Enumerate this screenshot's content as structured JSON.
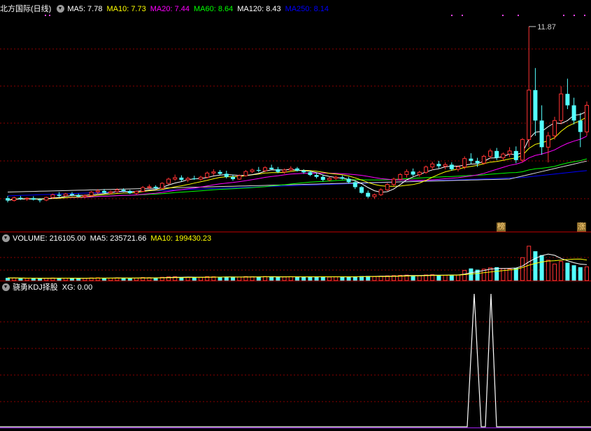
{
  "main": {
    "stock": "北方国际(日线)",
    "ma": [
      {
        "label": "MA5: 7.78",
        "color": "#ffffff"
      },
      {
        "label": "MA10: 7.73",
        "color": "#ffff00"
      },
      {
        "label": "MA20: 7.44",
        "color": "#ff00ff"
      },
      {
        "label": "MA60: 8.64",
        "color": "#00ff00"
      },
      {
        "label": "MA120: 8.43",
        "color": "#ffffff"
      },
      {
        "label": "MA250: 8.14",
        "color": "#0000ff"
      }
    ],
    "high_label": "11.87",
    "tags": {
      "bang": "榜",
      "zhang": "涨"
    }
  },
  "volume": {
    "label": "VOLUME: 216105.00",
    "ma5": "MA5: 235721.66",
    "ma10": "MA10: 199430.23"
  },
  "kdj": {
    "title": "骁勇KDJ择股",
    "xg": "XG: 0.00"
  },
  "colors": {
    "up": "#ff3232",
    "down": "#54ffff",
    "grid": "#8b0000",
    "divider": "#b00000",
    "ma5": "#ffffff",
    "ma10": "#ffff00",
    "ma20": "#ff00ff",
    "ma60": "#00ff00",
    "ma120": "#dddddd",
    "ma250": "#0000ff"
  },
  "chart_data": {
    "type": "candlestick",
    "price_range": [
      6.5,
      12.2
    ],
    "ohlc": [
      [
        7.36,
        7.42,
        7.25,
        7.3
      ],
      [
        7.3,
        7.4,
        7.27,
        7.37
      ],
      [
        7.37,
        7.42,
        7.31,
        7.34
      ],
      [
        7.34,
        7.38,
        7.29,
        7.36
      ],
      [
        7.36,
        7.41,
        7.3,
        7.32
      ],
      [
        7.32,
        7.36,
        7.25,
        7.31
      ],
      [
        7.31,
        7.4,
        7.28,
        7.38
      ],
      [
        7.38,
        7.48,
        7.35,
        7.45
      ],
      [
        7.45,
        7.52,
        7.38,
        7.42
      ],
      [
        7.42,
        7.5,
        7.4,
        7.47
      ],
      [
        7.47,
        7.52,
        7.41,
        7.44
      ],
      [
        7.44,
        7.48,
        7.38,
        7.4
      ],
      [
        7.4,
        7.46,
        7.36,
        7.43
      ],
      [
        7.43,
        7.55,
        7.41,
        7.52
      ],
      [
        7.52,
        7.6,
        7.47,
        7.55
      ],
      [
        7.55,
        7.6,
        7.48,
        7.5
      ],
      [
        7.5,
        7.56,
        7.46,
        7.53
      ],
      [
        7.53,
        7.62,
        7.5,
        7.58
      ],
      [
        7.58,
        7.62,
        7.52,
        7.55
      ],
      [
        7.55,
        7.58,
        7.47,
        7.49
      ],
      [
        7.49,
        7.56,
        7.45,
        7.54
      ],
      [
        7.54,
        7.68,
        7.52,
        7.64
      ],
      [
        7.64,
        7.72,
        7.6,
        7.66
      ],
      [
        7.66,
        7.7,
        7.6,
        7.62
      ],
      [
        7.62,
        7.78,
        7.6,
        7.75
      ],
      [
        7.75,
        7.9,
        7.72,
        7.86
      ],
      [
        7.86,
        7.98,
        7.82,
        7.9
      ],
      [
        7.9,
        7.96,
        7.8,
        7.84
      ],
      [
        7.84,
        7.92,
        7.78,
        7.88
      ],
      [
        7.88,
        7.95,
        7.84,
        7.86
      ],
      [
        7.86,
        7.95,
        7.82,
        7.91
      ],
      [
        7.91,
        8.06,
        7.88,
        8.02
      ],
      [
        8.02,
        8.12,
        7.96,
        8.05
      ],
      [
        8.05,
        8.1,
        7.97,
        8.0
      ],
      [
        8.0,
        8.08,
        7.88,
        7.92
      ],
      [
        7.92,
        7.98,
        7.82,
        7.86
      ],
      [
        7.86,
        7.98,
        7.84,
        7.95
      ],
      [
        7.95,
        8.1,
        7.93,
        8.06
      ],
      [
        8.06,
        8.14,
        8.02,
        8.1
      ],
      [
        8.1,
        8.18,
        8.04,
        8.08
      ],
      [
        8.08,
        8.2,
        8.05,
        8.16
      ],
      [
        8.16,
        8.24,
        8.1,
        8.12
      ],
      [
        8.12,
        8.18,
        8.02,
        8.05
      ],
      [
        8.05,
        8.14,
        8.0,
        8.1
      ],
      [
        8.1,
        8.2,
        8.06,
        8.14
      ],
      [
        8.14,
        8.18,
        8.06,
        8.08
      ],
      [
        8.08,
        8.12,
        8.0,
        8.04
      ],
      [
        8.04,
        8.08,
        7.94,
        7.97
      ],
      [
        7.97,
        8.02,
        7.88,
        7.92
      ],
      [
        7.92,
        7.98,
        7.8,
        7.84
      ],
      [
        7.84,
        7.92,
        7.8,
        7.88
      ],
      [
        7.88,
        7.95,
        7.84,
        7.91
      ],
      [
        7.91,
        7.96,
        7.85,
        7.87
      ],
      [
        7.87,
        7.92,
        7.74,
        7.78
      ],
      [
        7.78,
        7.82,
        7.6,
        7.65
      ],
      [
        7.65,
        7.68,
        7.48,
        7.5
      ],
      [
        7.5,
        7.56,
        7.36,
        7.4
      ],
      [
        7.4,
        7.48,
        7.34,
        7.45
      ],
      [
        7.45,
        7.62,
        7.42,
        7.58
      ],
      [
        7.58,
        7.76,
        7.55,
        7.72
      ],
      [
        7.72,
        7.9,
        7.68,
        7.86
      ],
      [
        7.86,
        8.02,
        7.82,
        7.98
      ],
      [
        7.98,
        8.12,
        7.9,
        8.06
      ],
      [
        8.06,
        8.14,
        7.94,
        7.98
      ],
      [
        7.98,
        8.08,
        7.92,
        8.04
      ],
      [
        8.04,
        8.22,
        8.0,
        8.18
      ],
      [
        8.18,
        8.32,
        8.1,
        8.26
      ],
      [
        8.26,
        8.34,
        8.14,
        8.2
      ],
      [
        8.2,
        8.3,
        8.12,
        8.24
      ],
      [
        8.24,
        8.3,
        8.08,
        8.12
      ],
      [
        8.12,
        8.22,
        8.06,
        8.18
      ],
      [
        8.18,
        8.46,
        8.12,
        8.4
      ],
      [
        8.4,
        8.54,
        8.26,
        8.34
      ],
      [
        8.34,
        8.42,
        8.18,
        8.28
      ],
      [
        8.28,
        8.5,
        8.24,
        8.46
      ],
      [
        8.46,
        8.66,
        8.4,
        8.6
      ],
      [
        8.6,
        8.68,
        8.36,
        8.42
      ],
      [
        8.42,
        8.56,
        8.36,
        8.52
      ],
      [
        8.52,
        8.7,
        8.44,
        8.6
      ],
      [
        8.6,
        8.72,
        8.28,
        8.36
      ],
      [
        8.36,
        8.94,
        8.3,
        8.9
      ],
      [
        8.9,
        11.87,
        8.7,
        10.2
      ],
      [
        10.2,
        10.78,
        9.0,
        9.4
      ],
      [
        9.4,
        9.8,
        8.5,
        8.7
      ],
      [
        8.7,
        9.1,
        8.3,
        9.0
      ],
      [
        9.0,
        9.5,
        8.9,
        9.4
      ],
      [
        9.4,
        10.3,
        9.3,
        10.1
      ],
      [
        10.1,
        10.5,
        9.7,
        9.8
      ],
      [
        9.8,
        10.0,
        9.3,
        9.4
      ],
      [
        9.4,
        9.6,
        8.7,
        9.1
      ],
      [
        9.1,
        9.9,
        9.0,
        9.8
      ]
    ],
    "volume_range": [
      0,
      560000
    ],
    "volume": [
      42000,
      40000,
      38000,
      35000,
      36000,
      33000,
      37000,
      41000,
      39000,
      38000,
      36000,
      34000,
      35000,
      42000,
      44000,
      40000,
      38000,
      43000,
      41000,
      37000,
      39000,
      48000,
      46000,
      42000,
      52000,
      58000,
      60000,
      54000,
      50000,
      48000,
      51000,
      62000,
      60000,
      55000,
      57000,
      52000,
      56000,
      63000,
      61000,
      58000,
      64000,
      60000,
      57000,
      59000,
      62000,
      58000,
      55000,
      60000,
      62000,
      64000,
      56000,
      58000,
      55000,
      61000,
      66000,
      70000,
      72000,
      62000,
      68000,
      74000,
      78000,
      82000,
      86000,
      80000,
      76000,
      88000,
      92000,
      86000,
      84000,
      90000,
      88000,
      160000,
      190000,
      170000,
      180000,
      200000,
      210000,
      190000,
      180000,
      200000,
      360000,
      540000,
      460000,
      400000,
      320000,
      260000,
      300000,
      280000,
      240000,
      210000,
      216105
    ]
  }
}
